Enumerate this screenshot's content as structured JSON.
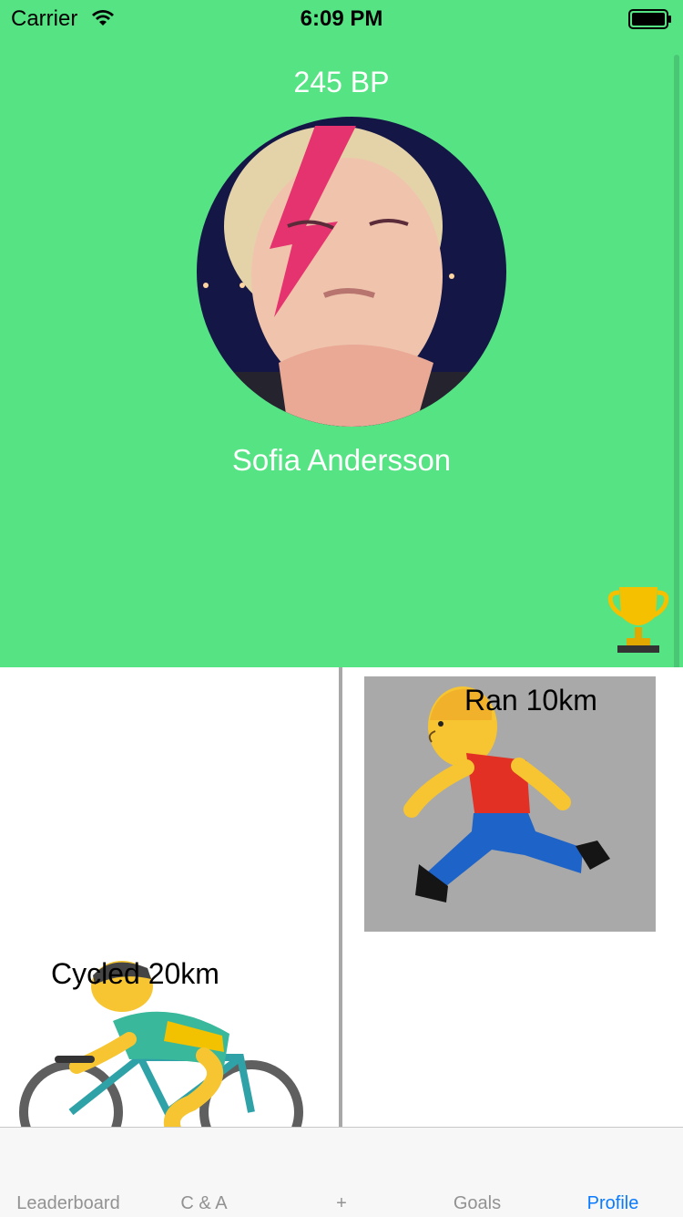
{
  "status_bar": {
    "carrier": "Carrier",
    "time": "6:09 PM",
    "icons": [
      "wifi-icon",
      "battery-icon"
    ]
  },
  "profile": {
    "points": "245 BP",
    "name": "Sofia Andersson",
    "avatar": "profile-photo",
    "trophy_icon": "trophy-icon"
  },
  "feed": {
    "items": [
      {
        "label": "Ran 10km",
        "icon": "runner-emoji"
      },
      {
        "label": "Cycled 20km",
        "icon": "cyclist-emoji"
      }
    ]
  },
  "tab_bar": {
    "tabs": [
      {
        "label": "Leaderboard",
        "active": false
      },
      {
        "label": "C & A",
        "active": false
      },
      {
        "label": "+",
        "active": false
      },
      {
        "label": "Goals",
        "active": false
      },
      {
        "label": "Profile",
        "active": true
      }
    ]
  },
  "colors": {
    "header_bg": "#55e384",
    "accent": "#0a7aff",
    "tab_inactive": "#929292",
    "card_bg": "#a9a9a9"
  }
}
